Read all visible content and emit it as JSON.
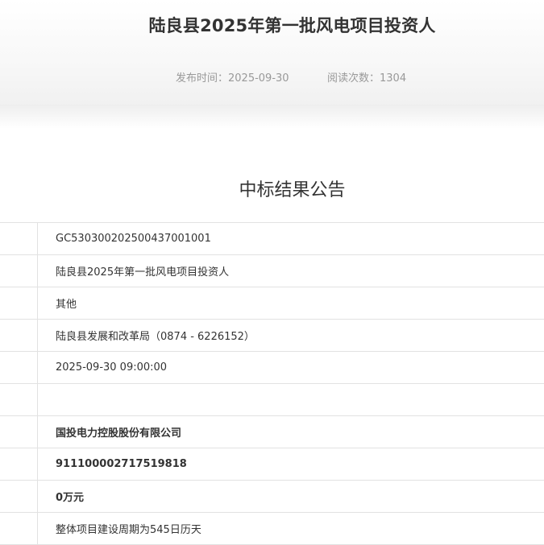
{
  "article": {
    "title": "陆良县2025年第一批风电项目投资人",
    "publish_time": "发布时间：2025-09-30",
    "read_count": "阅读次数：1304"
  },
  "notice": {
    "heading": "中标结果公告",
    "rows": [
      {
        "label": "",
        "value": "GC5303002025004370010​01"
      },
      {
        "label": "",
        "value": "陆良县2025年第一批风电项目投资人"
      },
      {
        "label": "",
        "value": "其他"
      },
      {
        "label": "",
        "value": "陆良县发展和改革局（0874 - 6226152）"
      },
      {
        "label": "",
        "value": "2025-09-30 09:00:00"
      },
      {
        "label": "",
        "value": ""
      },
      {
        "label": "",
        "value": "国投电力控股股份有限公司"
      },
      {
        "label": "",
        "value": "911100002717519818"
      },
      {
        "label": "",
        "value": "0万元"
      },
      {
        "label": "",
        "value": "整体项目建设周期为545日历天"
      }
    ]
  }
}
